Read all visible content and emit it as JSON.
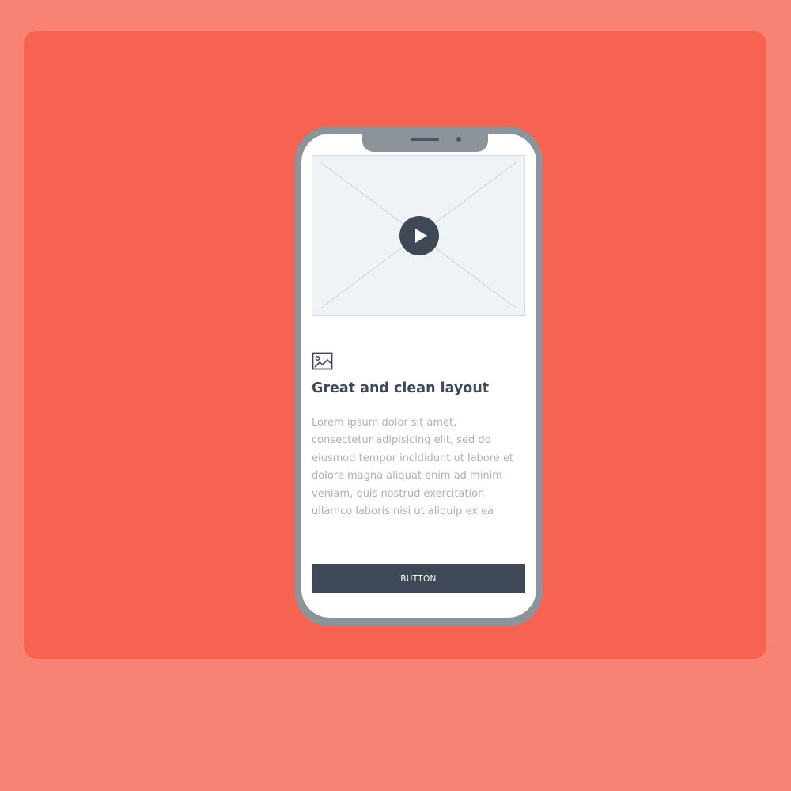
{
  "colors": {
    "outer_background": "#F88273",
    "panel_background": "#F66451",
    "phone_frame": "#8C939B",
    "screen": "#FFFFFF",
    "dark_accent": "#3F4856",
    "body_text": "#A9B2BB",
    "placeholder_fill": "#F0F3F6"
  },
  "video": {
    "play_icon": "play-icon"
  },
  "content": {
    "image_icon": "image-icon",
    "title": "Great and clean layout",
    "body_lines": [
      "Lorem ipsum dolor sit amet,",
      "consectetur adipisicing elit, sed do",
      "eiusmod tempor incididunt ut labore et",
      "dolore magna aliquat enim ad minim",
      "veniam, quis nostrud exercitation",
      "ullamco laboris nisi ut aliquip ex ea"
    ]
  },
  "button": {
    "label": "BUTTON"
  }
}
